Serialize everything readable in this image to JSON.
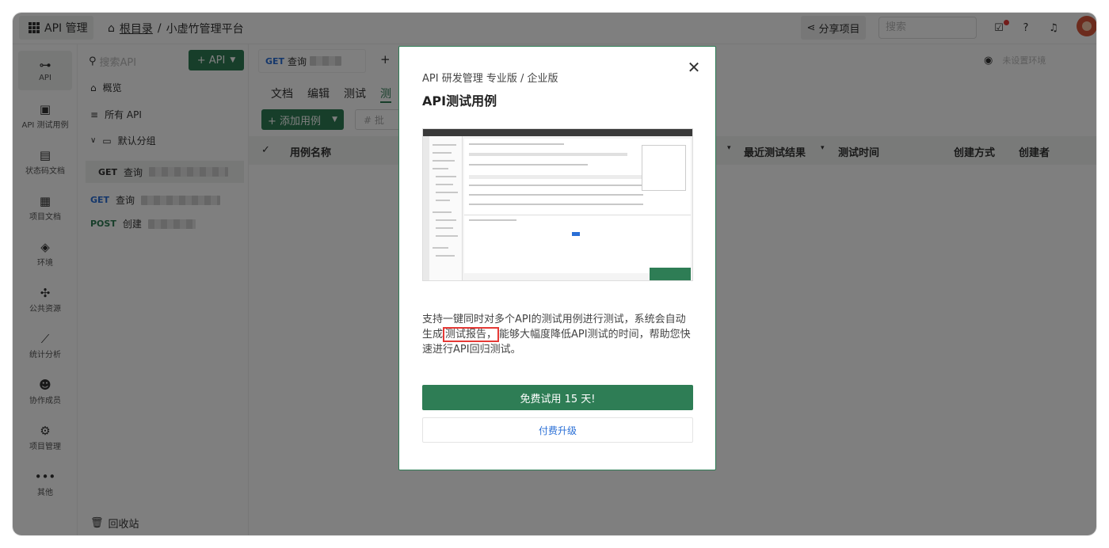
{
  "topbar": {
    "app_label": "API 管理",
    "breadcrumb_root": "根目录",
    "breadcrumb_sep": "/",
    "project_name": "小虚竹管理平台",
    "share_label": "分享项目",
    "search_placeholder": "搜索"
  },
  "nav": [
    {
      "label": "API",
      "icon": "link-icon"
    },
    {
      "label": "API 测试用例",
      "icon": "test-case-icon"
    },
    {
      "label": "状态码文档",
      "icon": "status-code-icon"
    },
    {
      "label": "项目文档",
      "icon": "document-icon"
    },
    {
      "label": "环境",
      "icon": "environment-icon"
    },
    {
      "label": "公共资源",
      "icon": "puzzle-icon"
    },
    {
      "label": "统计分析",
      "icon": "chart-icon"
    },
    {
      "label": "协作成员",
      "icon": "members-icon"
    },
    {
      "label": "项目管理",
      "icon": "settings-icon"
    },
    {
      "label": "其他",
      "icon": "more-icon"
    }
  ],
  "tree": {
    "search_placeholder": "搜索API",
    "add_api_label": "+ API",
    "overview": "概览",
    "all_api": "所有 API",
    "default_group": "默认分组",
    "items": [
      {
        "method": "GET",
        "name": "查询"
      },
      {
        "method": "GET",
        "name": "查询"
      },
      {
        "method": "POST",
        "name": "创建"
      }
    ],
    "recycle": "回收站"
  },
  "main": {
    "tab_method": "GET",
    "tab_name": "查询",
    "env_placeholder": "未设置环境",
    "subtabs": [
      "文档",
      "编辑",
      "测试",
      "测"
    ],
    "add_case_label": "+ 添加用例",
    "ghost_btn": "# 批",
    "columns": [
      "用例名称",
      "最近测试结果",
      "测试时间",
      "创建方式",
      "创建者"
    ]
  },
  "modal": {
    "subtitle": "API 研发管理 专业版 / 企业版",
    "title": "API测试用例",
    "desc_before": "支持一键同时对多个API的测试用例进行测试，系统会自动生成",
    "desc_highlight": "测试报告，",
    "desc_after": "能够大幅度降低API测试的时间，帮助您快速进行API回归测试。",
    "trial_label": "免费试用 15 天!",
    "upgrade_label": "付费升级",
    "close_symbol": "✕"
  },
  "colors": {
    "accent": "#2e7d55",
    "link": "#2a6fd6",
    "highlight_border": "#e53935"
  }
}
